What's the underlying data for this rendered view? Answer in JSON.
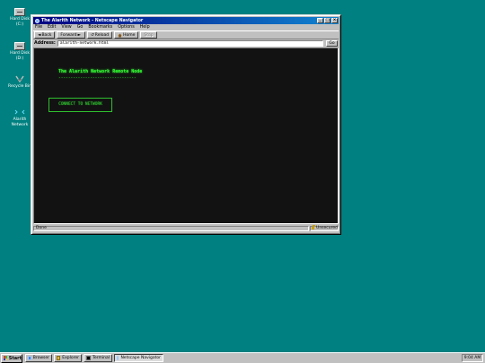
{
  "desktop": {
    "background_color": "#008080",
    "icons": [
      {
        "label": "Hard Disk (C:)",
        "icon": "hard-disk-icon"
      },
      {
        "label": "Hard Disk (D:)",
        "icon": "hard-disk-icon"
      },
      {
        "label": "Recycle Bin",
        "icon": "recycle-bin-icon"
      },
      {
        "label": "Alarith Network",
        "icon": "network-icon"
      }
    ]
  },
  "window": {
    "title": "The Alarith Network - Netscape Navigator",
    "titlebar_buttons": [
      "_",
      "□",
      "×"
    ],
    "menu": [
      "File",
      "Edit",
      "View",
      "Go",
      "Bookmarks",
      "Options",
      "Help"
    ],
    "toolbar": {
      "back_icon": "◄",
      "back_label": "Back",
      "forward_label": "Forward",
      "forward_icon": "►",
      "reload_icon": "↺",
      "reload_label": "Reload",
      "home_label": "Home",
      "stop_label": "Stop"
    },
    "address": {
      "label": "Address:",
      "value": "alarith-network.html",
      "go_label": "Go"
    },
    "page": {
      "background": "#121212",
      "accent": "#33ff33",
      "heading": "The Alarith Network Remote Node",
      "heading_rule": "--------------------------------",
      "connect_label": "CONNECT TO NETWORK"
    },
    "status": {
      "left": "Done",
      "right": "Unsecured"
    }
  },
  "taskbar": {
    "start_label": "Start",
    "tasks": [
      {
        "label": "Browser",
        "icon": "globe-icon",
        "active": false
      },
      {
        "label": "Explorer",
        "icon": "folder-icon",
        "active": false
      },
      {
        "label": "Terminal",
        "icon": "terminal-icon",
        "active": false
      },
      {
        "label": "Netscape Navigator",
        "icon": "globe-icon",
        "active": true
      }
    ],
    "clock": "9:04 AM"
  }
}
